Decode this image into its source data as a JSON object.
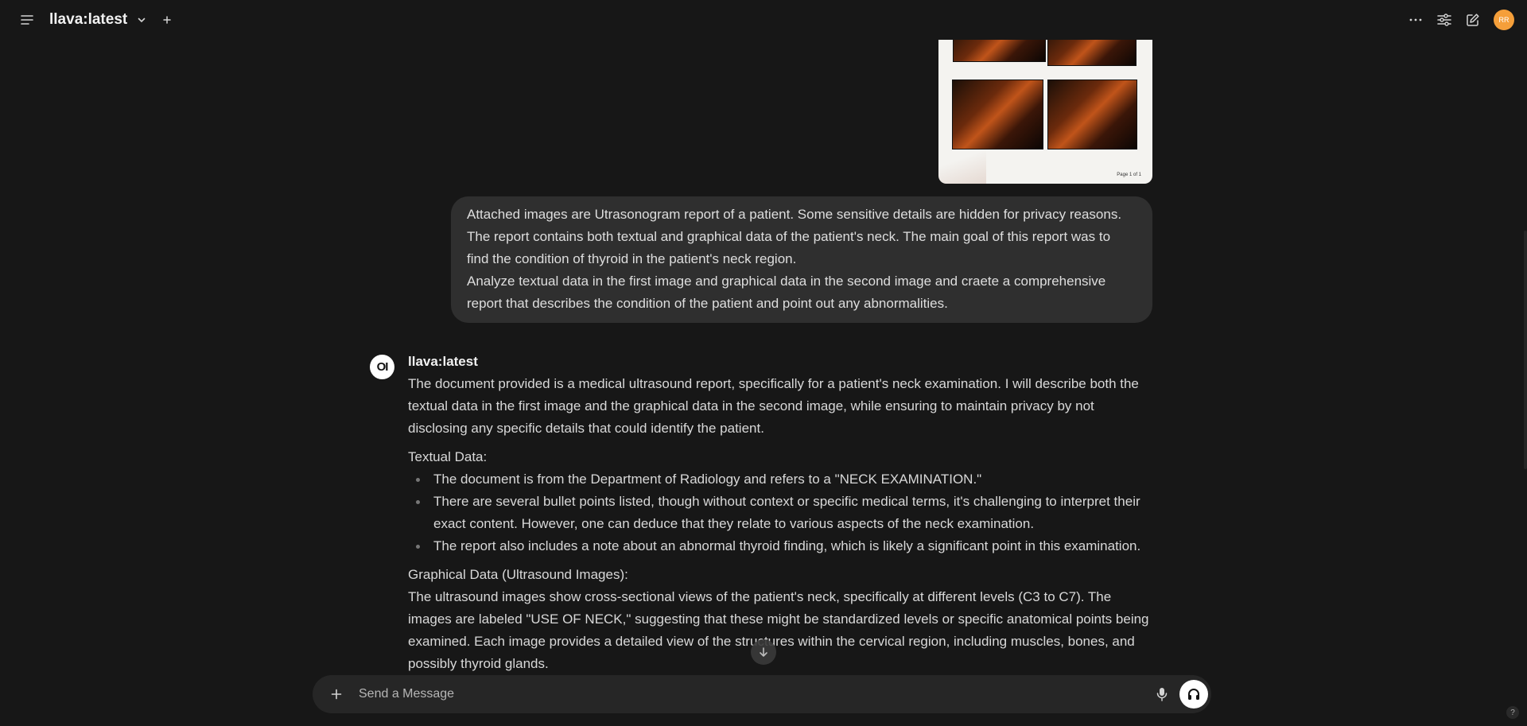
{
  "header": {
    "model_name": "llava:latest",
    "icons": [
      "menu-icon",
      "chevron-down-icon",
      "plus-icon",
      "more-icon",
      "sliders-icon",
      "edit-icon"
    ],
    "avatar_initials": "RR",
    "avatar_color": "#f59f3a"
  },
  "attachment": {
    "page_label": "Page 1 of 1"
  },
  "user_message": {
    "lines": [
      "Attached images are Utrasonogram report of a patient. Some sensitive details are hidden for privacy reasons.",
      "The report contains both textual and graphical data of the patient's neck. The main goal of this report was to",
      "find the condition of thyroid in the patient's neck region.",
      "Analyze textual data in the first image and graphical data in the second image and craete a comprehensive",
      "report that describes the condition of the patient and point out any abnormalities."
    ]
  },
  "assistant": {
    "avatar_text": "OI",
    "name": "llava:latest",
    "intro": "The document provided is a medical ultrasound report, specifically for a patient's neck examination. I will describe both the textual data in the first image and the graphical data in the second image, while ensuring to maintain privacy by not disclosing any specific details that could identify the patient.",
    "textual_heading": "Textual Data:",
    "bullets": [
      "The document is from the Department of Radiology and refers to a \"NECK EXAMINATION.\"",
      "There are several bullet points listed, though without context or specific medical terms, it's challenging to interpret their exact content. However, one can deduce that they relate to various aspects of the neck examination.",
      "The report also includes a note about an abnormal thyroid finding, which is likely a significant point in this examination."
    ],
    "graphical_heading": "Graphical Data (Ultrasound Images):",
    "graphical_text": "The ultrasound images show cross-sectional views of the patient's neck, specifically at different levels (C3 to C7). The images are labeled \"USE OF NECK,\" suggesting that these might be standardized levels or specific anatomical points being examined. Each image provides a detailed view of the structures within the cervical region, including muscles, bones, and possibly thyroid glands."
  },
  "composer": {
    "placeholder": "Send a Message"
  },
  "help_label": "?"
}
